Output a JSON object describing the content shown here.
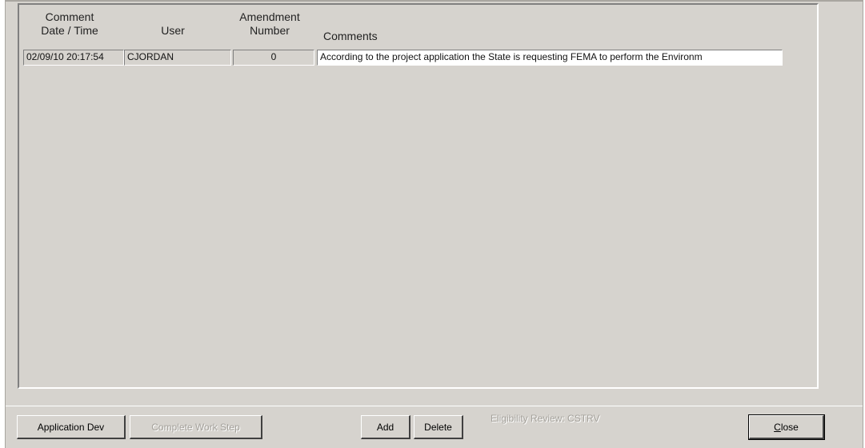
{
  "grid": {
    "headers": {
      "comment_date_time": [
        "Comment",
        "Date / Time"
      ],
      "user": "User",
      "amendment_number": [
        "Amendment",
        "Number"
      ],
      "comments": "Comments"
    },
    "rows": [
      {
        "date_time": "02/09/10 20:17:54",
        "user": "CJORDAN",
        "amendment_number": "0",
        "comment": "According to the project application the State is requesting FEMA to perform the Environm"
      }
    ]
  },
  "footer": {
    "application_dev": "Application Dev",
    "complete_work_step": "Complete Work Step",
    "add": "Add",
    "delete": "Delete",
    "status": "Eligibility Review: CSTRV",
    "close": "Close"
  }
}
